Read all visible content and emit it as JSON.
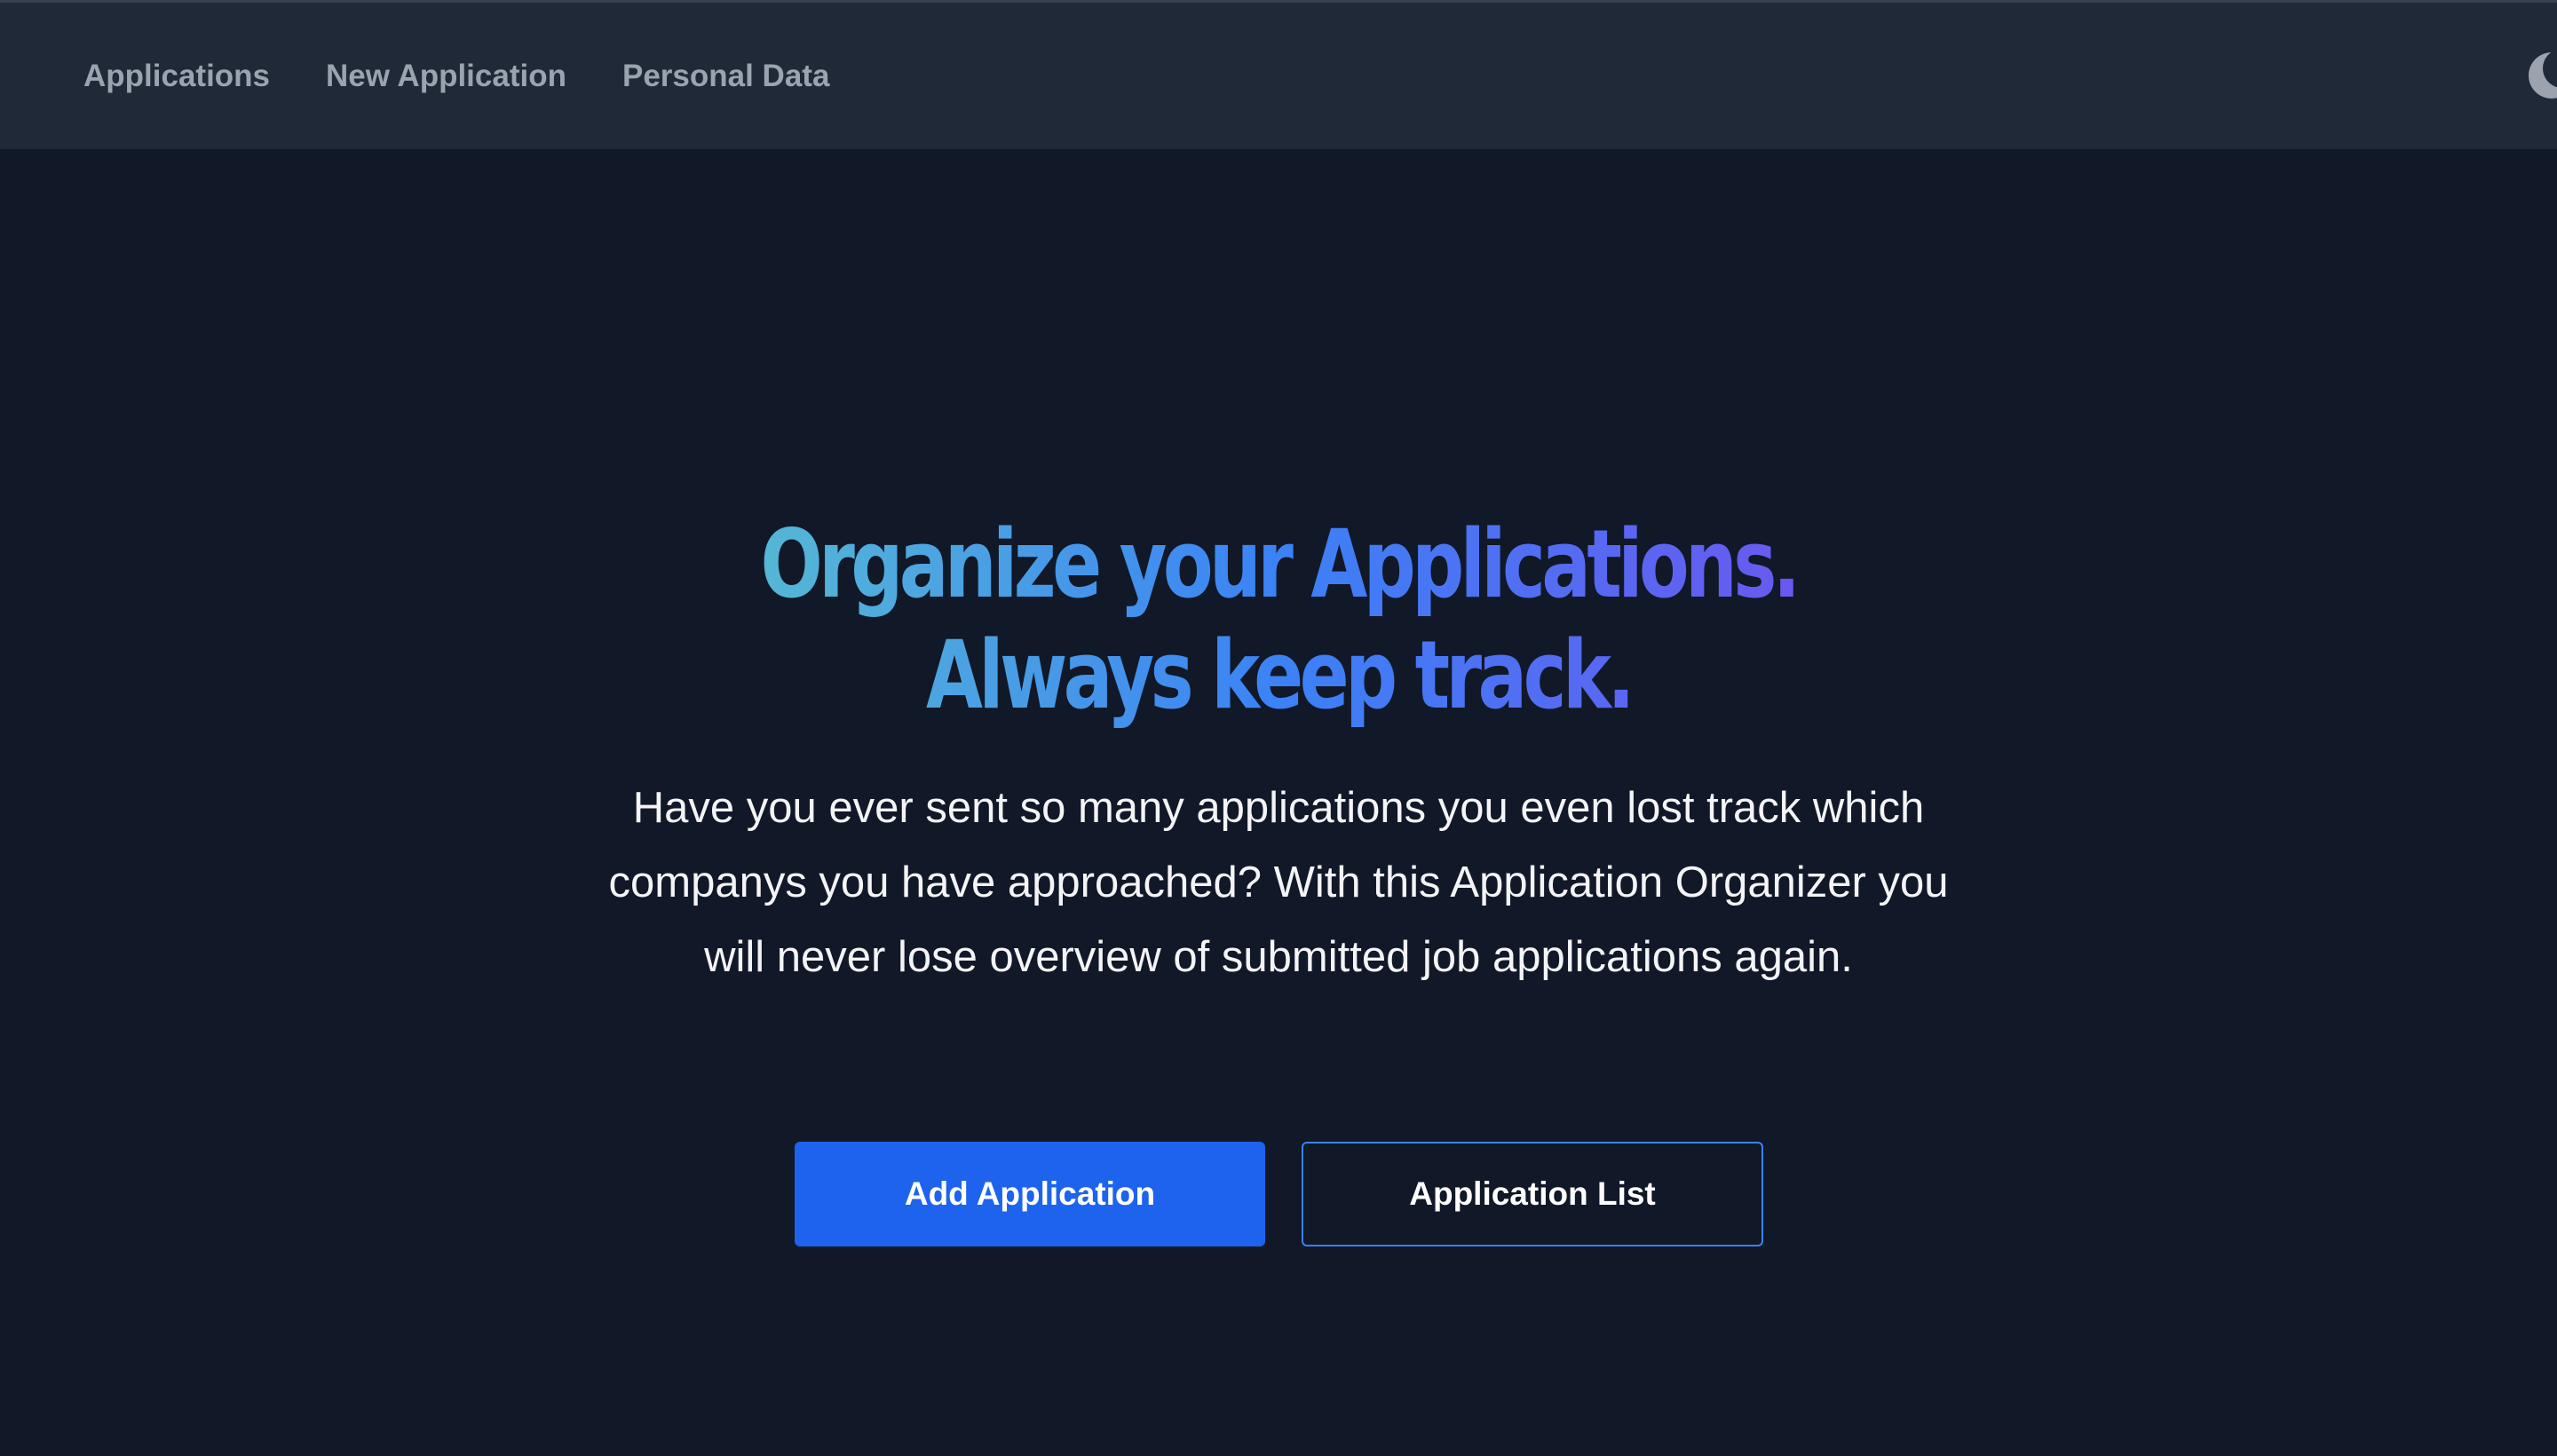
{
  "nav": {
    "links": [
      {
        "label": "Applications"
      },
      {
        "label": "New Application"
      },
      {
        "label": "Personal Data"
      }
    ],
    "theme_toggle_icon": "moon-icon"
  },
  "hero": {
    "headline_line1_a": "Organize your ",
    "headline_line1_b": "Applications.",
    "headline_line2": "Always keep track.",
    "description": "Have you ever sent so many applications you even lost track which companys you have approached? With this Application Organizer you will never lose overview of submitted job applications again.",
    "primary_button": "Add Application",
    "secondary_button": "Application List"
  },
  "colors": {
    "background": "#111827",
    "navbar": "#1f2937",
    "nav_text": "#9ca3af",
    "primary_button": "#1d63ed",
    "secondary_border": "#3b82f6",
    "gradient_start": "#6ee7b7",
    "gradient_mid": "#3b82f6",
    "gradient_end": "#9333ea"
  }
}
